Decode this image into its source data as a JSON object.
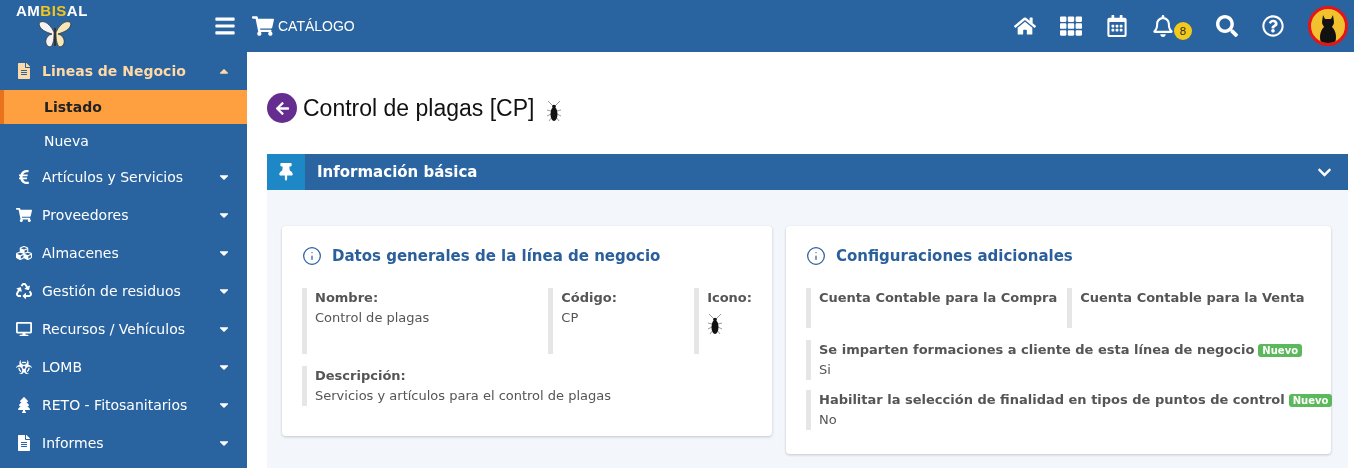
{
  "header": {
    "logo": [
      {
        "text": "AM",
        "highlight": false
      },
      {
        "text": "BIS",
        "highlight": true
      },
      {
        "text": "AL"
      }
    ],
    "catalog": "CATÁLOGO",
    "actions": [
      {
        "kind": "home"
      },
      {
        "kind": "apps"
      },
      {
        "kind": "calendar"
      },
      {
        "kind": "bell",
        "badge": "8"
      },
      {
        "kind": "search"
      },
      {
        "kind": "help"
      }
    ]
  },
  "sidebar": {
    "items": [
      {
        "label": "Lineas de Negocio",
        "expanded": true,
        "children": [
          {
            "label": "Listado",
            "selected": true
          },
          {
            "label": "Nueva",
            "selected": false
          }
        ]
      },
      {
        "label": "Artículos y Servicios",
        "expanded": false
      },
      {
        "label": "Proveedores",
        "expanded": false
      },
      {
        "label": "Almacenes",
        "expanded": false
      },
      {
        "label": "Gestión de residuos",
        "expanded": false
      },
      {
        "label": "Recursos / Vehículos",
        "expanded": false
      },
      {
        "label": "LOMB",
        "expanded": false
      },
      {
        "label": "RETO - Fitosanitarios",
        "expanded": false
      },
      {
        "label": "Informes",
        "expanded": false
      }
    ]
  },
  "page": {
    "title": "Control de plagas [CP]"
  },
  "panel": {
    "title": "Información básica",
    "expanded": true,
    "general": {
      "title": "Datos generales de la línea de negocio",
      "fields": [
        {
          "label": "Nombre:",
          "value": "Control de plagas"
        },
        {
          "label": "Código:",
          "value": "CP"
        }
      ],
      "icon_label": "Icono:",
      "description": {
        "label": "Descripción:",
        "value": "Servicios y artículos para el control de plagas"
      }
    },
    "config": {
      "title": "Configuraciones adicionales",
      "accounts": [
        {
          "label": "Cuenta Contable para la Compra"
        },
        {
          "label": "Cuenta Contable para la Venta"
        }
      ],
      "options": [
        {
          "label": "Se imparten formaciones a cliente de esta línea de negocio",
          "badge": "Nuevo",
          "value": "Si"
        },
        {
          "label": "Habilitar la selección de finalidad en tipos de puntos de control",
          "badge": "Nuevo",
          "value": "No"
        }
      ]
    }
  }
}
